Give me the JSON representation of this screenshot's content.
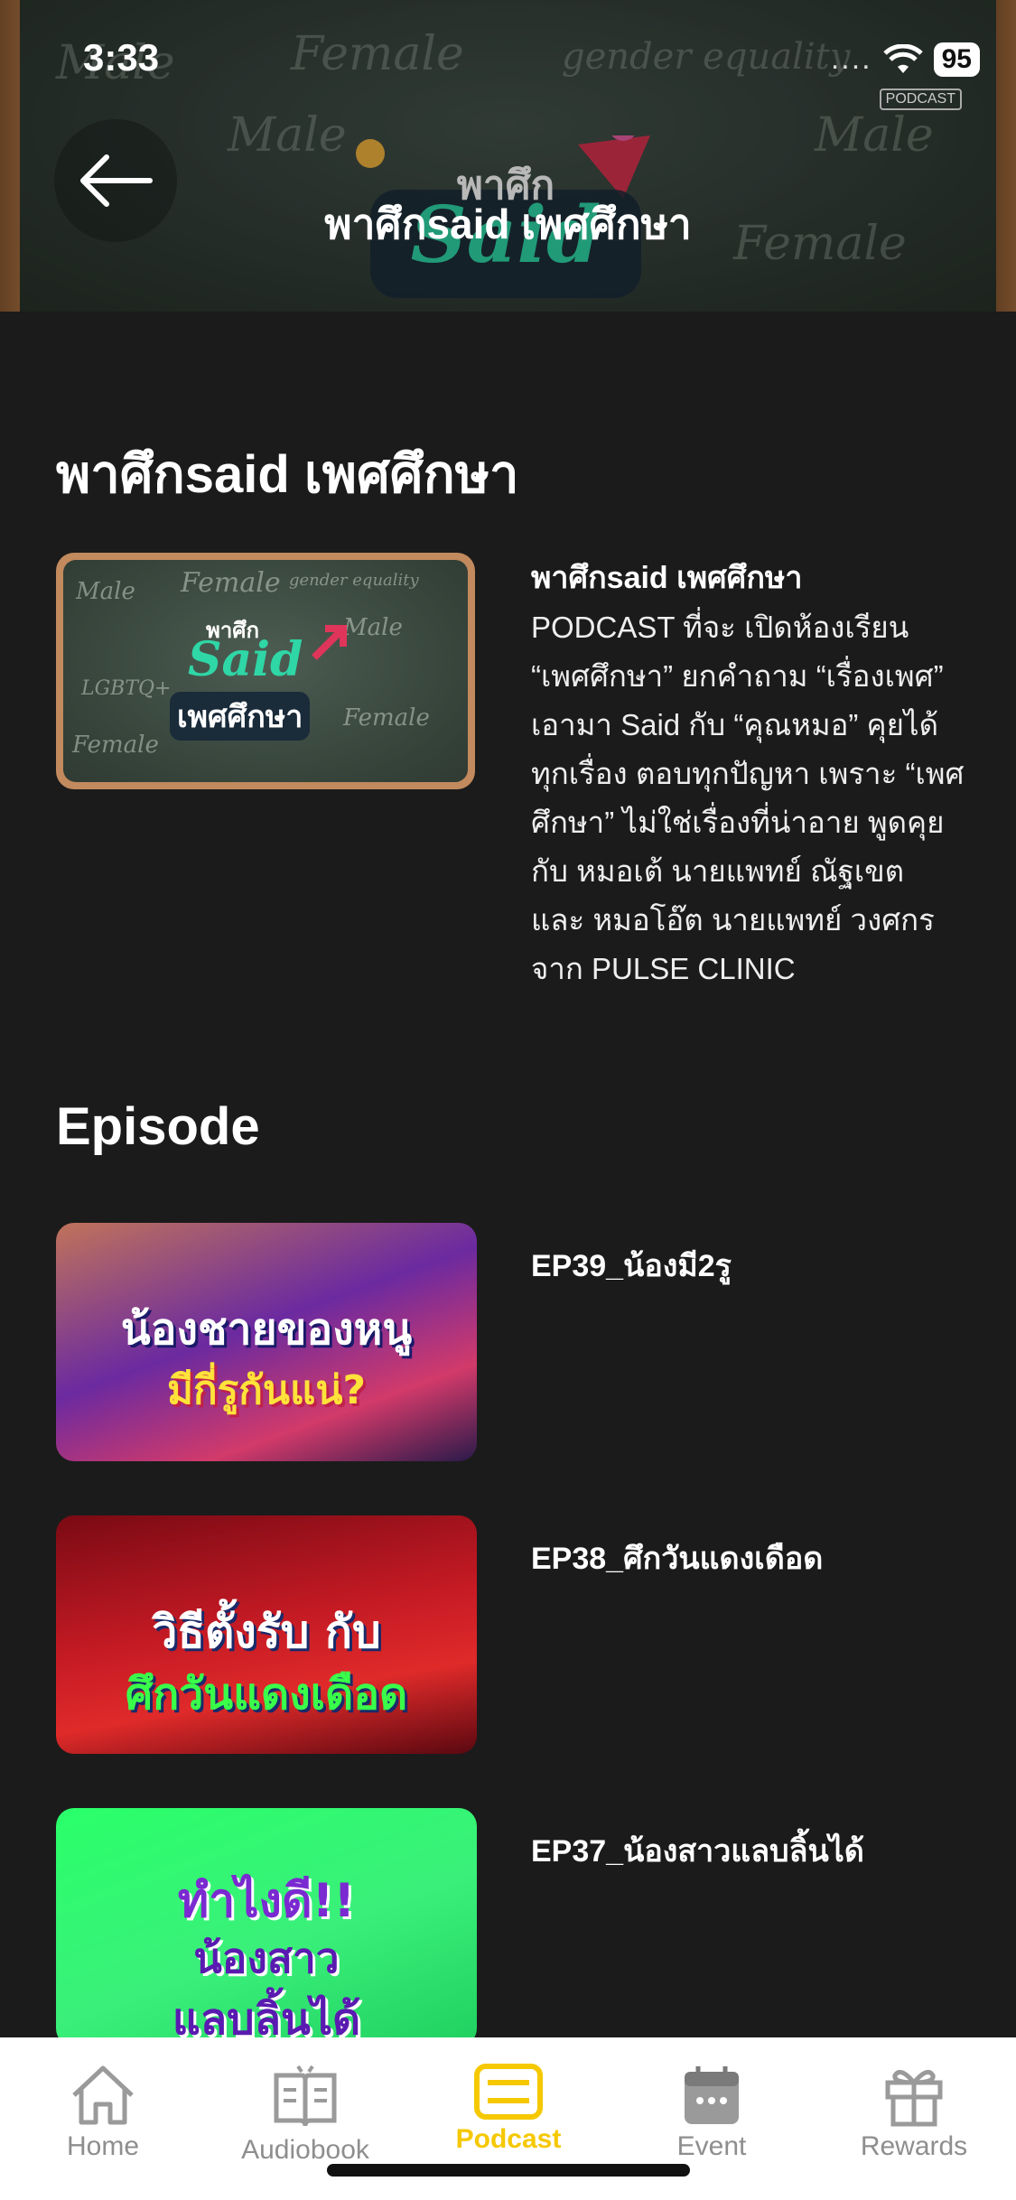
{
  "status_bar": {
    "time": "3:33",
    "signal": "....",
    "battery": "95"
  },
  "header": {
    "title": "พาศึกsaid เพศศึกษา",
    "back_icon": "arrow-left-icon"
  },
  "banner_art": {
    "logo_line1": "พาศึก",
    "logo_line2": "Said",
    "badge": "PODCAST"
  },
  "podcast": {
    "title": "พาศึกsaid เพศศึกษา",
    "info_title": "พาศึกsaid เพศศึกษา",
    "description": "PODCAST ที่จะ เปิดห้องเรียน “เพศศึกษา” ยกคำถาม “เรื่องเพศ” เอามา Said กับ “คุณหมอ” คุยได้ทุกเรื่อง ตอบทุกปัญหา เพราะ “เพศศึกษา” ไม่ใช่เรื่องที่น่าอาย พูดคุยกับ หมอเต้ นายแพทย์ ณัฐเขต และ หมอโอ๊ต นายแพทย์ วงศกร จาก PULSE CLINIC",
    "cover": {
      "line1": "พาศึก",
      "line2": "Said",
      "line3": "เพศศึกษา"
    }
  },
  "episodes_section": {
    "title": "Episode"
  },
  "episodes": [
    {
      "title": "EP39_น้องมี2รู",
      "thumb_line1": "น้องชายของหนู",
      "thumb_line2": "มีกี่รูกันแน่?"
    },
    {
      "title": "EP38_ศึกวันแดงเดือด",
      "thumb_line1": "วิธีตั้งรับ กับ",
      "thumb_line2": "ศึกวันแดงเดือด"
    },
    {
      "title": "EP37_น้องสาวแลบลิ้นได้",
      "thumb_line1": "ทำไงดี!!",
      "thumb_line2": "น้องสาว",
      "thumb_line3": "แลบลิ้นได้"
    }
  ],
  "tabbar": {
    "items": [
      {
        "label": "Home",
        "icon": "home-icon",
        "active": false
      },
      {
        "label": "Audiobook",
        "icon": "book-icon",
        "active": false
      },
      {
        "label": "Podcast",
        "icon": "podcast-icon",
        "active": true
      },
      {
        "label": "Event",
        "icon": "calendar-icon",
        "active": false
      },
      {
        "label": "Rewards",
        "icon": "gift-icon",
        "active": false
      }
    ]
  },
  "colors": {
    "background": "#1b1b1b",
    "accent": "#f5c800",
    "tab_inactive": "#8e8e8e"
  }
}
